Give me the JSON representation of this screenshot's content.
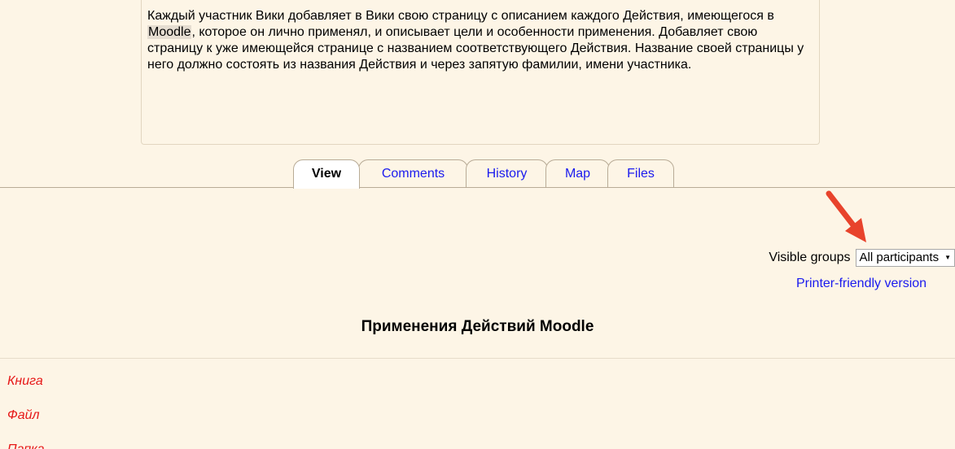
{
  "intro": {
    "text_before": "Каждый участник Вики добавляет в Вики свою страницу  с описанием каждого Действия, имеющегося в ",
    "highlight": "Moodle",
    "text_after": ", которое он лично применял, и описывает цели и особенности применения. Добавляет свою страницу к уже имеющейся странице с названием соответствующего Действия. Название своей страницы у него должно состоять из названия Действия и через запятую фамилии, имени участника."
  },
  "tabs": [
    {
      "label": "View",
      "active": true
    },
    {
      "label": "Comments",
      "active": false
    },
    {
      "label": "History",
      "active": false
    },
    {
      "label": "Map",
      "active": false
    },
    {
      "label": "Files",
      "active": false
    }
  ],
  "groups": {
    "label": "Visible groups",
    "selected": "All participants"
  },
  "printer_link": "Printer-friendly version",
  "page_title": "Применения Действий Moodle",
  "links": [
    "Книга",
    "Файл",
    "Папка"
  ],
  "colors": {
    "background": "#fdf5e6",
    "link": "#1a1aee",
    "missing_link": "#e61717",
    "arrow": "#e8432c"
  }
}
